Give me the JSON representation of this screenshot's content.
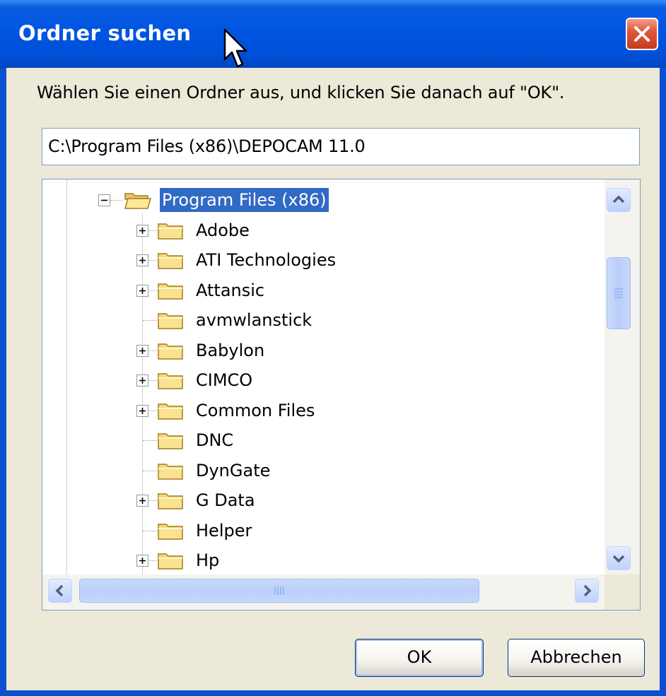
{
  "window": {
    "title": "Ordner suchen",
    "close_label": "✕"
  },
  "instruction": "Wählen Sie einen Ordner aus, und klicken Sie danach auf \"OK\".",
  "path": {
    "value": "C:\\Program Files (x86)\\DEPOCAM 11.0"
  },
  "tree": {
    "selected": "Program Files (x86)",
    "items": [
      {
        "label": "Program Files (x86)",
        "expandable": true,
        "expanded": true,
        "selected": true,
        "icon": "open-folder-icon"
      },
      {
        "label": "Adobe",
        "expandable": true,
        "icon": "folder-icon"
      },
      {
        "label": "ATI Technologies",
        "expandable": true,
        "icon": "folder-icon"
      },
      {
        "label": "Attansic",
        "expandable": true,
        "icon": "folder-icon"
      },
      {
        "label": "avmwlanstick",
        "expandable": false,
        "icon": "folder-icon"
      },
      {
        "label": "Babylon",
        "expandable": true,
        "icon": "folder-icon"
      },
      {
        "label": "CIMCO",
        "expandable": true,
        "icon": "folder-icon"
      },
      {
        "label": "Common Files",
        "expandable": true,
        "icon": "folder-icon"
      },
      {
        "label": "DNC",
        "expandable": false,
        "icon": "folder-icon"
      },
      {
        "label": "DynGate",
        "expandable": false,
        "icon": "folder-icon"
      },
      {
        "label": "G Data",
        "expandable": true,
        "icon": "folder-icon"
      },
      {
        "label": "Helper",
        "expandable": false,
        "icon": "folder-icon"
      },
      {
        "label": "Hp",
        "expandable": true,
        "icon": "folder-icon"
      }
    ]
  },
  "buttons": {
    "ok": "OK",
    "cancel": "Abbrechen"
  },
  "colors": {
    "titlebar": "#0054e3",
    "selection": "#316ac5",
    "dialog_bg": "#ece9d8",
    "close_button": "#e2563a"
  }
}
